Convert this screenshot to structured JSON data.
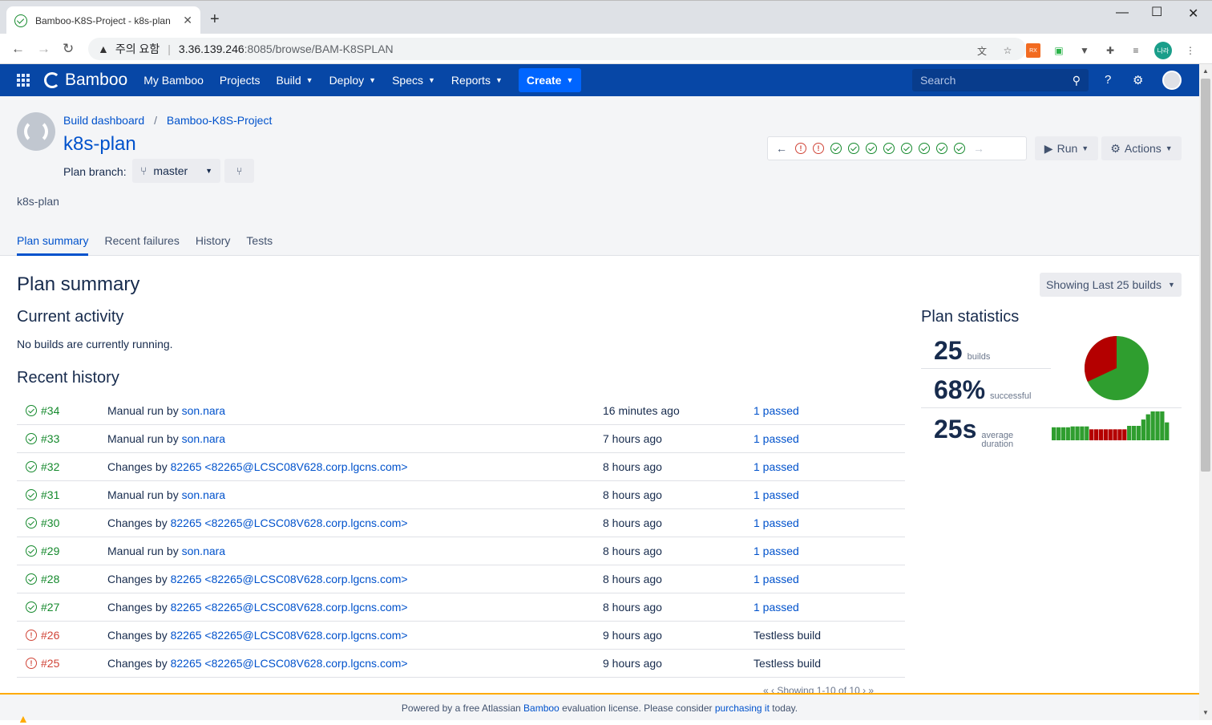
{
  "browser": {
    "tab_title": "Bamboo-K8S-Project - k8s-plan",
    "tab_close": "✕",
    "new_tab": "+",
    "address_warning": "주의 요함",
    "url_host": "3.36.139.246",
    "url_rest": ":8085/browse/BAM-K8SPLAN",
    "profile_initials": "나라"
  },
  "topnav": {
    "logo_text": "Bamboo",
    "items": [
      {
        "label": "My Bamboo",
        "dropdown": false
      },
      {
        "label": "Projects",
        "dropdown": false
      },
      {
        "label": "Build",
        "dropdown": true
      },
      {
        "label": "Deploy",
        "dropdown": true
      },
      {
        "label": "Specs",
        "dropdown": true
      },
      {
        "label": "Reports",
        "dropdown": true
      }
    ],
    "create_label": "Create",
    "search_placeholder": "Search"
  },
  "header": {
    "breadcrumb": [
      "Build dashboard",
      "Bamboo-K8S-Project"
    ],
    "breadcrumb_sep": "/",
    "title": "k8s-plan",
    "branch_label": "Plan branch:",
    "branch_value": "master",
    "plan_key": "k8s-plan",
    "tabs": [
      "Plan summary",
      "Recent failures",
      "History",
      "Tests"
    ],
    "active_tab": "Plan summary",
    "status_strip": [
      "fail",
      "fail",
      "ok",
      "ok",
      "ok",
      "ok",
      "ok",
      "ok",
      "ok",
      "ok"
    ],
    "run_label": "Run",
    "actions_label": "Actions"
  },
  "main": {
    "heading": "Plan summary",
    "showing_label": "Showing Last 25 builds",
    "current_activity_heading": "Current activity",
    "current_activity_text": "No builds are currently running.",
    "recent_history_heading": "Recent history",
    "pager_text": "Showing 1-10 of 10"
  },
  "history": [
    {
      "num": "#34",
      "status": "ok",
      "prefix": "Manual run by",
      "who": "son.nara",
      "when": "16 minutes ago",
      "result": "1 passed",
      "result_link": true
    },
    {
      "num": "#33",
      "status": "ok",
      "prefix": "Manual run by",
      "who": "son.nara",
      "when": "7 hours ago",
      "result": "1 passed",
      "result_link": true
    },
    {
      "num": "#32",
      "status": "ok",
      "prefix": "Changes by",
      "who": "82265 <82265@LCSC08V628.corp.lgcns.com>",
      "when": "8 hours ago",
      "result": "1 passed",
      "result_link": true
    },
    {
      "num": "#31",
      "status": "ok",
      "prefix": "Manual run by",
      "who": "son.nara",
      "when": "8 hours ago",
      "result": "1 passed",
      "result_link": true
    },
    {
      "num": "#30",
      "status": "ok",
      "prefix": "Changes by",
      "who": "82265 <82265@LCSC08V628.corp.lgcns.com>",
      "when": "8 hours ago",
      "result": "1 passed",
      "result_link": true
    },
    {
      "num": "#29",
      "status": "ok",
      "prefix": "Manual run by",
      "who": "son.nara",
      "when": "8 hours ago",
      "result": "1 passed",
      "result_link": true
    },
    {
      "num": "#28",
      "status": "ok",
      "prefix": "Changes by",
      "who": "82265 <82265@LCSC08V628.corp.lgcns.com>",
      "when": "8 hours ago",
      "result": "1 passed",
      "result_link": true
    },
    {
      "num": "#27",
      "status": "ok",
      "prefix": "Changes by",
      "who": "82265 <82265@LCSC08V628.corp.lgcns.com>",
      "when": "8 hours ago",
      "result": "1 passed",
      "result_link": true
    },
    {
      "num": "#26",
      "status": "fail",
      "prefix": "Changes by",
      "who": "82265 <82265@LCSC08V628.corp.lgcns.com>",
      "when": "9 hours ago",
      "result": "Testless build",
      "result_link": false
    },
    {
      "num": "#25",
      "status": "fail",
      "prefix": "Changes by",
      "who": "82265 <82265@LCSC08V628.corp.lgcns.com>",
      "when": "9 hours ago",
      "result": "Testless build",
      "result_link": false
    }
  ],
  "stats": {
    "heading": "Plan statistics",
    "builds_value": "25",
    "builds_label": "builds",
    "success_value": "68%",
    "success_label": "successful",
    "duration_value": "25s",
    "duration_label_1": "average",
    "duration_label_2": "duration",
    "pie_success_fraction": 0.68,
    "colors": {
      "success": "#2f9e2f",
      "fail": "#b40000"
    },
    "duration_bars": [
      {
        "h": 0.45,
        "s": "ok"
      },
      {
        "h": 0.45,
        "s": "ok"
      },
      {
        "h": 0.45,
        "s": "ok"
      },
      {
        "h": 0.45,
        "s": "ok"
      },
      {
        "h": 0.48,
        "s": "ok"
      },
      {
        "h": 0.48,
        "s": "ok"
      },
      {
        "h": 0.48,
        "s": "ok"
      },
      {
        "h": 0.48,
        "s": "ok"
      },
      {
        "h": 0.38,
        "s": "fail"
      },
      {
        "h": 0.38,
        "s": "fail"
      },
      {
        "h": 0.38,
        "s": "fail"
      },
      {
        "h": 0.38,
        "s": "fail"
      },
      {
        "h": 0.38,
        "s": "fail"
      },
      {
        "h": 0.38,
        "s": "fail"
      },
      {
        "h": 0.38,
        "s": "fail"
      },
      {
        "h": 0.38,
        "s": "fail"
      },
      {
        "h": 0.5,
        "s": "ok"
      },
      {
        "h": 0.5,
        "s": "ok"
      },
      {
        "h": 0.5,
        "s": "ok"
      },
      {
        "h": 0.72,
        "s": "ok"
      },
      {
        "h": 0.9,
        "s": "ok"
      },
      {
        "h": 1.0,
        "s": "ok"
      },
      {
        "h": 1.0,
        "s": "ok"
      },
      {
        "h": 1.0,
        "s": "ok"
      },
      {
        "h": 0.62,
        "s": "ok"
      }
    ]
  },
  "footer": {
    "pre": "Powered by a free Atlassian",
    "link1": "Bamboo",
    "mid": "evaluation license. Please consider",
    "link2": "purchasing it",
    "post": "today."
  }
}
